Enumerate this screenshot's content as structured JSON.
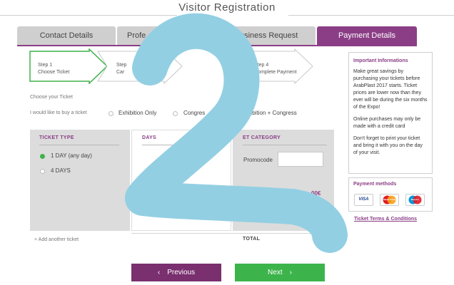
{
  "title": "Visitor Registration",
  "tabs": [
    {
      "label": "Contact Details"
    },
    {
      "label": "Profe"
    },
    {
      "label": "Business Request"
    },
    {
      "label": "Payment Details"
    }
  ],
  "steps": [
    {
      "line1": "Step 1",
      "line2": "Choose Ticket"
    },
    {
      "line1": "Step",
      "line2": "Car"
    },
    {
      "line1": "Step 4",
      "line2": "Complete Payment"
    }
  ],
  "choose_ticket": "Choose your Ticket",
  "buy_label": "I would like to buy a ticket",
  "ticket_options": [
    "Exhibition Only",
    "Congres",
    "hibition + Congress"
  ],
  "panels": {
    "ticket_type": "TICKET TYPE",
    "days": "DAYS",
    "ticket_category": "ET CATEGORY",
    "day_options": [
      "1 DAY (any day)",
      "4 DAYS"
    ],
    "promocode_label": "Promocode",
    "price": "00€",
    "total": "TOTAL",
    "add_ticket": "+ Add another ticket"
  },
  "sidebar": {
    "info_title": "Important Informations",
    "info_p1": "Make great savings by purchasing your tickets before ArabPlast 2017 starts. Ticket prices are lower now than they ever will be during the six months of the Expo!",
    "info_p2": "Online purchases may only be made with a credit card",
    "info_p3": "Don't forget to print your ticket and bring it with you on the day of your visit.",
    "payment_title": "Payment methods",
    "cards": [
      "VISA",
      "MasterCard",
      "Maestro"
    ],
    "terms": "Ticket Terms & Conditions"
  },
  "buttons": {
    "previous": "Previous",
    "next": "Next"
  },
  "colors": {
    "purple": "#8b3e86",
    "green": "#3cb44b",
    "overlay": "#93cfe3"
  }
}
